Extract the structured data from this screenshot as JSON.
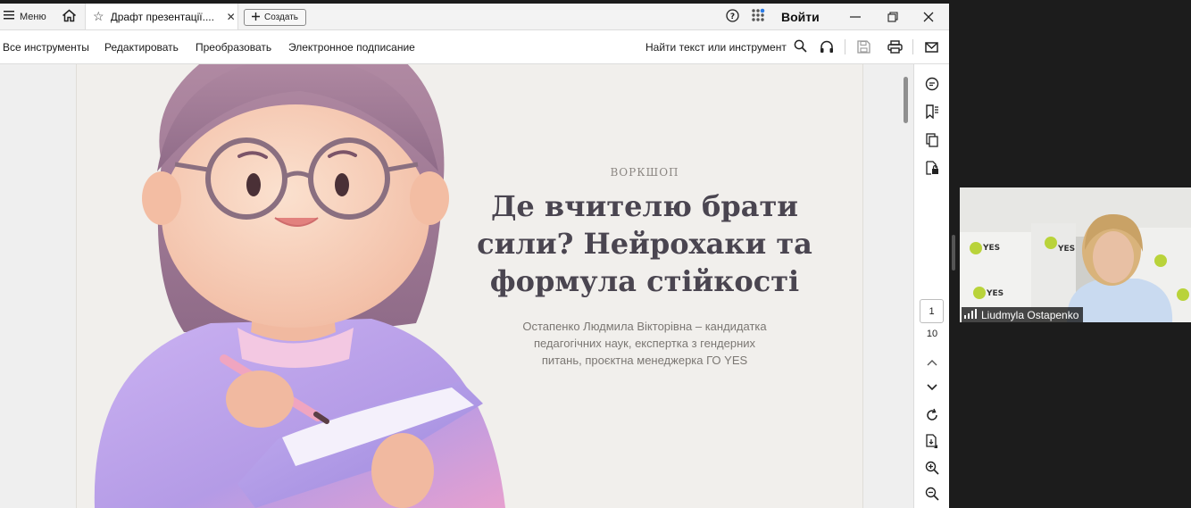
{
  "topbar": {
    "menu_label": "Меню",
    "tab_title": "Драфт презентації....",
    "create_label": "Создать",
    "login_label": "Войти"
  },
  "toolbar": {
    "items": [
      "Все инструменты",
      "Редактировать",
      "Преобразовать",
      "Электронное подписание"
    ],
    "find_label": "Найти текст или инструмент"
  },
  "slide": {
    "kicker": "ВОРКШОП",
    "headline_lines": [
      "Де вчителю брати",
      "сили? Нейрохаки та",
      "формула стійкості"
    ],
    "subline_lines": [
      "Остапенко Людмила Вікторівна – кандидатка",
      "педагогічних наук, експертка з гендерних",
      "питань, проєктна менеджерка ГО YES"
    ]
  },
  "pager": {
    "current": "1",
    "total": "10"
  },
  "video": {
    "participant": "Liudmyla Ostapenko",
    "box_label": "YES"
  },
  "colors": {
    "headline": "#4a4550",
    "accent_purple": "#b59ee8",
    "hair": "#a57f9c"
  }
}
